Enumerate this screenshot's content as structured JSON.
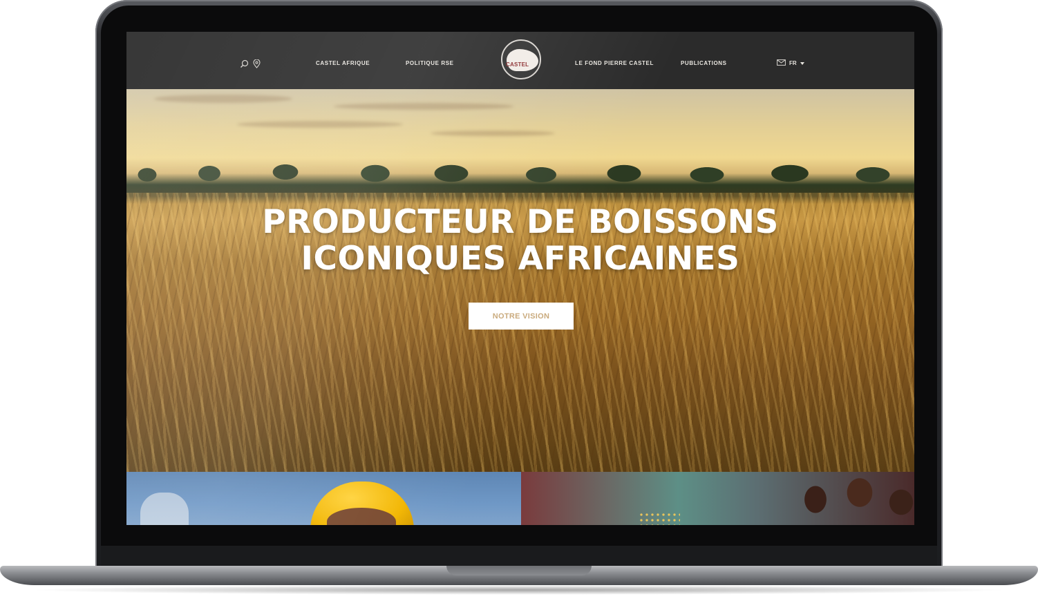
{
  "header": {
    "nav_left": [
      "CASTEL AFRIQUE",
      "POLITIQUE RSE"
    ],
    "nav_right": [
      "LE FOND PIERRE CASTEL",
      "PUBLICATIONS"
    ],
    "logo_text": "CASTEL",
    "language": "FR",
    "icons": [
      "search-icon",
      "location-pin-icon",
      "mail-icon",
      "caret-down-icon"
    ]
  },
  "hero": {
    "title_line1": "PRODUCTEUR DE BOISSONS",
    "title_line2": "ICONIQUES AFRICAINES",
    "button_label": "NOTRE VISION"
  },
  "colors": {
    "header_bg": "#2b2b2b",
    "nav_text": "#e9e6e0",
    "button_text": "#c9a97b",
    "logo_accent": "#8b2d2f"
  }
}
